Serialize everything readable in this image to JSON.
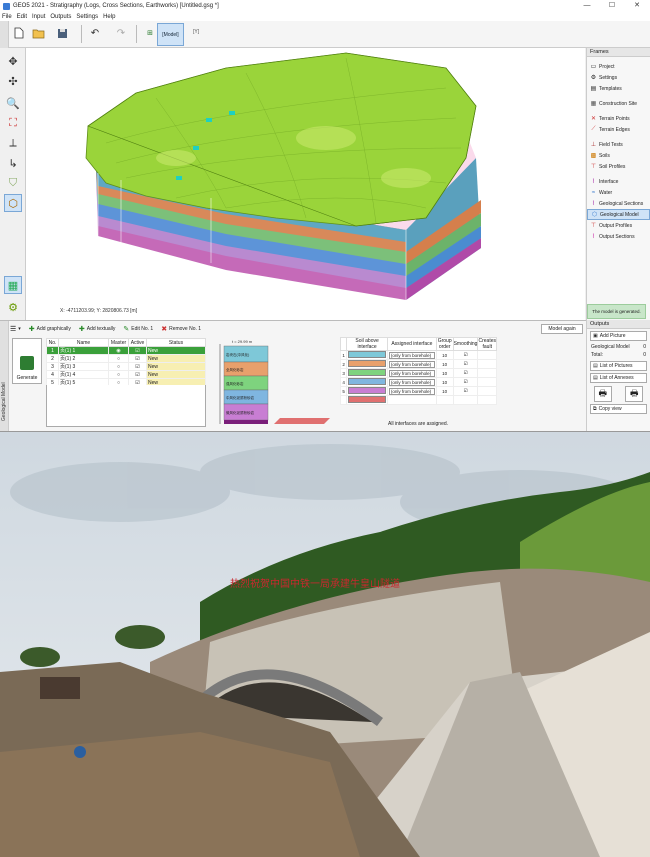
{
  "app": {
    "title": "GEO5 2021 - Stratigraphy (Logs, Cross Sections, Earthworks) [Untitled.gsg *]",
    "window_controls": [
      "—",
      "☐",
      "✕"
    ]
  },
  "menu": [
    "File",
    "Edit",
    "Input",
    "Outputs",
    "Settings",
    "Help"
  ],
  "toolbar": {
    "model_label": "[Model]",
    "y_label": "[Y]"
  },
  "viewport": {
    "coords": "X: -4711203.99; Y: 2820806.73 [m]"
  },
  "frames": {
    "header": "Frames",
    "items": [
      {
        "label": "Project",
        "icon": "doc-icon",
        "group": 1
      },
      {
        "label": "Settings",
        "icon": "gear-icon",
        "group": 1
      },
      {
        "label": "Templates",
        "icon": "template-icon",
        "group": 1
      },
      {
        "label": "Construction Site",
        "icon": "site-icon",
        "group": 2
      },
      {
        "label": "Terrain Points",
        "icon": "points-icon",
        "group": 3
      },
      {
        "label": "Terrain Edges",
        "icon": "edges-icon",
        "group": 3
      },
      {
        "label": "Field Tests",
        "icon": "field-test-icon",
        "group": 4
      },
      {
        "label": "Soils",
        "icon": "soils-icon",
        "group": 4
      },
      {
        "label": "Soil Profiles",
        "icon": "profile-icon",
        "group": 4
      },
      {
        "label": "Interface",
        "icon": "interface-icon",
        "group": 5
      },
      {
        "label": "Water",
        "icon": "water-icon",
        "group": 5
      },
      {
        "label": "Geological Sections",
        "icon": "sections-icon",
        "group": 5
      },
      {
        "label": "Geological Model",
        "icon": "model-icon",
        "group": 5,
        "selected": true
      },
      {
        "label": "Output Profiles",
        "icon": "output-profile-icon",
        "group": 5
      },
      {
        "label": "Output Sections",
        "icon": "output-section-icon",
        "group": 5
      }
    ],
    "status": "The model is generated."
  },
  "lower": {
    "tab_label": "Geological Model",
    "actions": {
      "add_graphically": "Add graphically",
      "add_textually": "Add textually",
      "edit": "Edit No. 1",
      "remove": "Remove No. 1",
      "model_again": "Model again"
    },
    "generate": "Generate",
    "interfaces": {
      "headers": [
        "No.",
        "Name",
        "Master",
        "Active",
        "Status"
      ],
      "rows": [
        {
          "no": "1",
          "name": "页(1) 1",
          "master": true,
          "active": true,
          "status": "New"
        },
        {
          "no": "2",
          "name": "页(1) 2",
          "master": false,
          "active": true,
          "status": "New"
        },
        {
          "no": "3",
          "name": "页(1) 3",
          "master": false,
          "active": true,
          "status": "New"
        },
        {
          "no": "4",
          "name": "页(1) 4",
          "master": false,
          "active": true,
          "status": "New"
        },
        {
          "no": "5",
          "name": "页(1) 5",
          "master": false,
          "active": true,
          "status": "New"
        }
      ]
    },
    "profile": {
      "label": "t = 29.99 m",
      "layers": [
        {
          "label": "岩块石(中风化)",
          "color": "#7ec8d8"
        },
        {
          "label": "全风化砂岩",
          "color": "#e8a06c"
        },
        {
          "label": "强风化砂岩",
          "color": "#7ed37e"
        },
        {
          "label": "中风化泥质粉砂岩",
          "color": "#7fb6e0"
        },
        {
          "label": "微风化泥质粉砂岩",
          "color": "#c87ed3"
        }
      ]
    },
    "layers_table": {
      "headers": [
        "",
        "Soil above interface",
        "Assigned interface",
        "Group order",
        "Smoothing",
        "Creates fault"
      ],
      "rows": [
        {
          "no": "1",
          "color": "#7ec8d8",
          "assigned": "(only from borehole)",
          "order": "10",
          "smooth": true
        },
        {
          "no": "2",
          "color": "#e8a06c",
          "assigned": "(only from borehole)",
          "order": "10",
          "smooth": true
        },
        {
          "no": "3",
          "color": "#7ed37e",
          "assigned": "(only from borehole)",
          "order": "10",
          "smooth": true
        },
        {
          "no": "4",
          "color": "#7fb6e0",
          "assigned": "(only from borehole)",
          "order": "10",
          "smooth": true
        },
        {
          "no": "5",
          "color": "#c87ed3",
          "assigned": "(only from borehole)",
          "order": "10",
          "smooth": true
        },
        {
          "no": "",
          "color": "#e07070",
          "assigned": "",
          "order": "",
          "smooth": false
        }
      ],
      "message": "All interfaces are assigned."
    }
  },
  "outputs": {
    "header": "Outputs",
    "add_picture": "Add Picture",
    "geo_model_label": "Geological Model",
    "geo_model_count": "0",
    "total_label": "Total:",
    "total_count": "0",
    "list_pictures": "List of Pictures",
    "list_annexes": "List of Annexes",
    "copy_view": "Copy view"
  },
  "photo": {
    "banner": "热烈祝贺中国中铁一局承建牛皇山隧道"
  }
}
